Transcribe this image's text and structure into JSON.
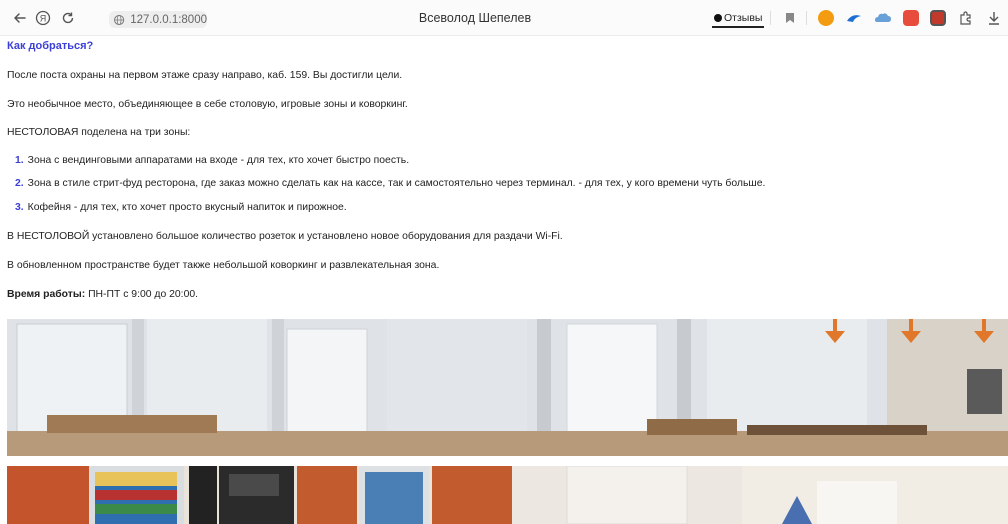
{
  "browser": {
    "url": "127.0.0.1:8000",
    "tab_title": "Всеволод Шепелев",
    "reviews_label": "Отзывы",
    "icons": [
      "back-arrow-icon",
      "yandex-logo-icon",
      "reload-icon",
      "globe-icon",
      "bookmark-icon",
      "extension-orange-icon",
      "extension-blue-bird-icon",
      "extension-cloud-icon",
      "extension-red-cake-icon",
      "extension-calendar-icon",
      "extension-puzzle-icon",
      "download-icon"
    ]
  },
  "page": {
    "heading": "Как добраться?",
    "p1": "После поста охраны на первом этаже сразу направо, каб. 159. Вы достигли цели.",
    "p2": "Это необычное место, объединяющее в себе столовую, игровые зоны и коворкинг.",
    "p3": "НЕСТОЛОВАЯ поделена на три зоны:",
    "zones": [
      {
        "num": "1.",
        "text": "Зона с вендинговыми аппаратами на входе - для тех, кто хочет быстро поесть."
      },
      {
        "num": "2.",
        "text": "Зона в стиле стрит-фуд ресторона, где заказ можно сделать как на кассе, так и самостоятельно через терминал. - для тех, у кого времени чуть больше."
      },
      {
        "num": "3.",
        "text": "Кофейня - для тех, кто хочет просто вкусный напиток и пирожное."
      }
    ],
    "p4": "В НЕСТОЛОВОЙ установлено большое количество розеток и установлено новое оборудования для раздачи Wi-Fi.",
    "p5": "В обновленном пространстве будет также небольшой коворкинг и развлекательная зона.",
    "hours_label": "Время работы:",
    "hours_value": " ПН-ПТ с 9:00 до 20:00."
  }
}
